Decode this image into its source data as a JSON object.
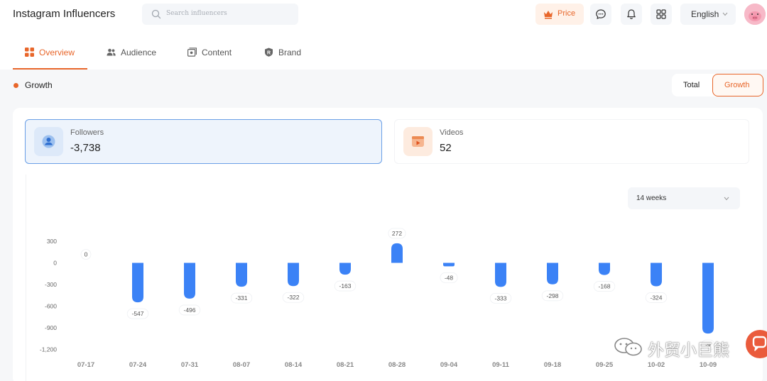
{
  "header": {
    "title": "Instagram Influencers",
    "search_placeholder": "Search influencers",
    "price_label": "Price",
    "language": "English"
  },
  "tabs": [
    {
      "label": "Overview",
      "active": true
    },
    {
      "label": "Audience",
      "active": false
    },
    {
      "label": "Content",
      "active": false
    },
    {
      "label": "Brand",
      "active": false
    }
  ],
  "section": {
    "title": "Growth",
    "toggle": {
      "options": [
        "Total",
        "Growth"
      ],
      "selected": "Growth"
    }
  },
  "stats": {
    "followers": {
      "label": "Followers",
      "value": "-3,738",
      "icon": "user-icon"
    },
    "videos": {
      "label": "Videos",
      "value": "52",
      "icon": "video-icon"
    }
  },
  "range_select": {
    "value": "14 weeks"
  },
  "colors": {
    "accent": "#e8662a",
    "bar": "#3b82f6",
    "selected_card_border": "#6a9fe6"
  },
  "chart_data": {
    "type": "bar",
    "categories": [
      "07-17",
      "07-24",
      "07-31",
      "08-07",
      "08-14",
      "08-21",
      "08-28",
      "09-04",
      "09-11",
      "09-18",
      "09-25",
      "10-02",
      "10-09"
    ],
    "values": [
      0,
      -547,
      -496,
      -331,
      -322,
      -163,
      272,
      -48,
      -333,
      -298,
      -168,
      -324,
      -980
    ],
    "data_labels": [
      "0",
      "-547",
      "-496",
      "-331",
      "-322",
      "-163",
      "272",
      "-48",
      "-333",
      "-298",
      "-168",
      "-324",
      "-9"
    ],
    "y_ticks": [
      300,
      0,
      -300,
      -600,
      -900,
      -1200
    ],
    "y_tick_labels": [
      "300",
      "0",
      "-300",
      "-600",
      "-900",
      "-1,200"
    ],
    "ylim": [
      -1200,
      300
    ],
    "grid": false,
    "legend": "none"
  },
  "watermark": {
    "text": "外贸小巨熊"
  }
}
